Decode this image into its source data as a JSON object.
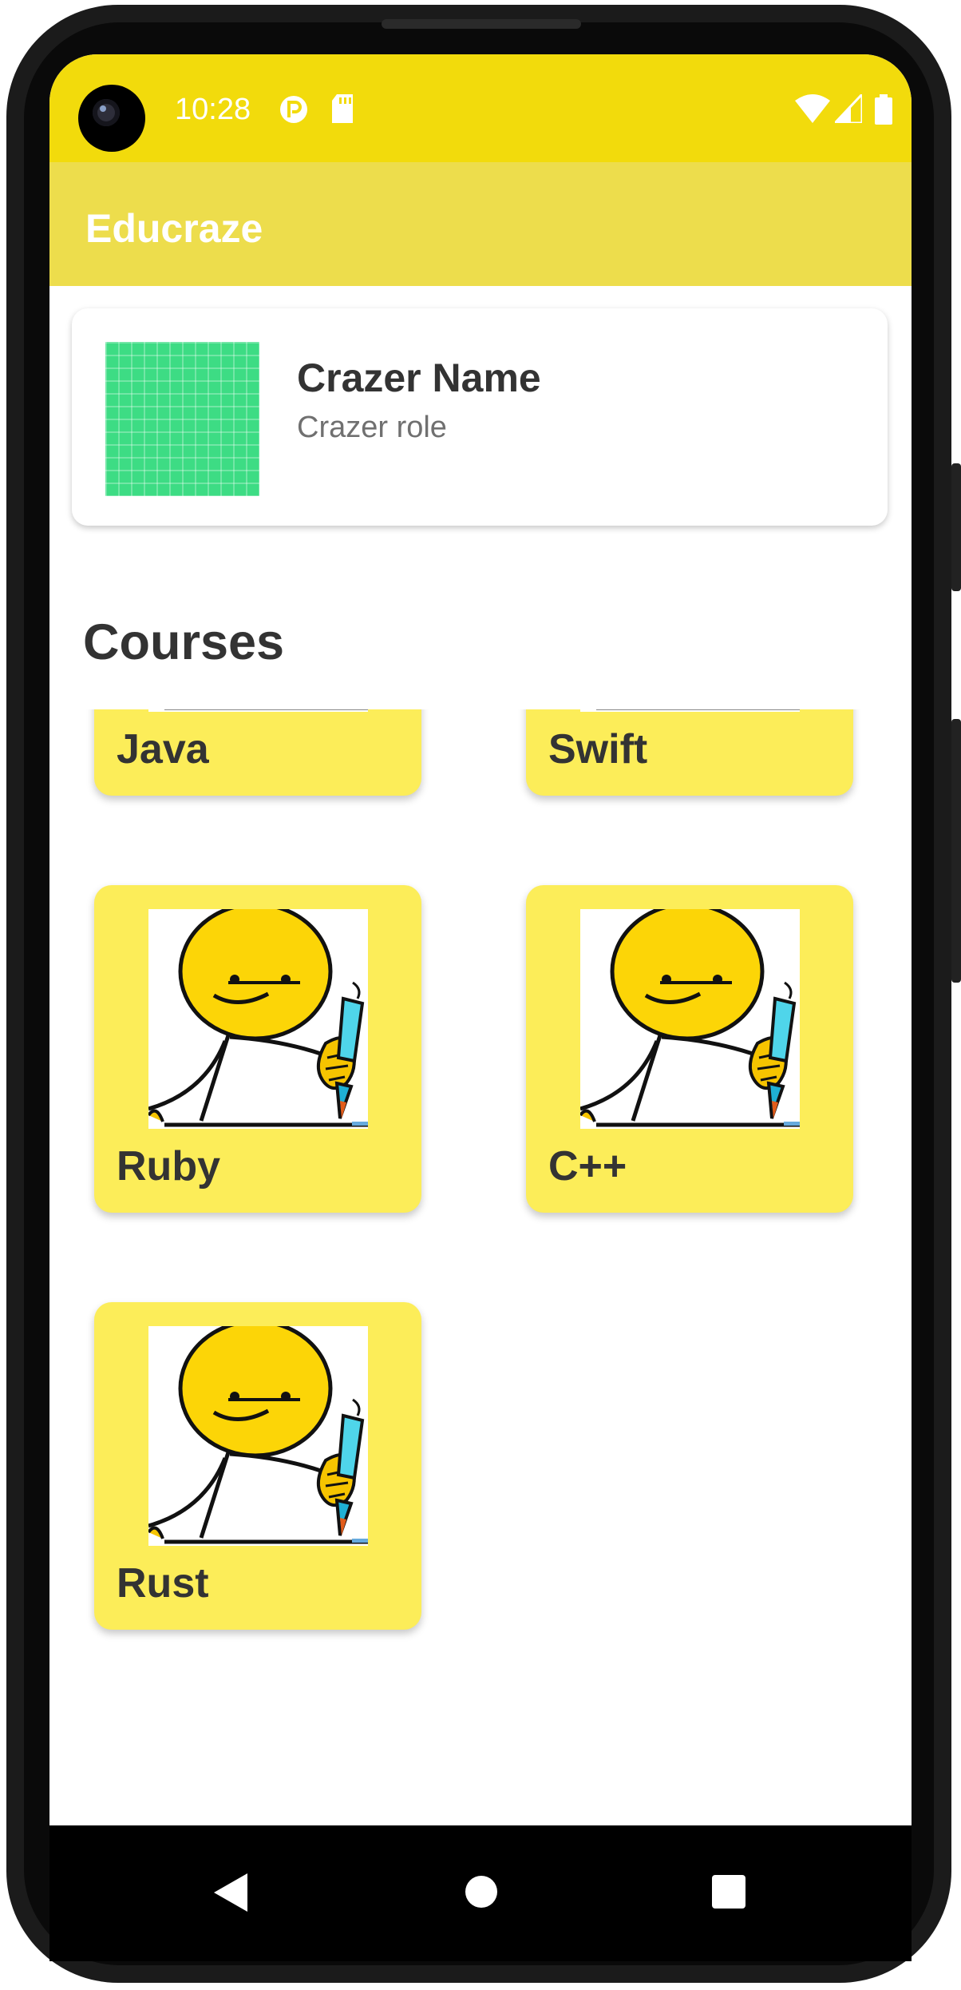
{
  "status": {
    "time": "10:28",
    "icons": [
      "notification-r-icon",
      "sd-card-icon",
      "wifi-icon",
      "signal-icon",
      "battery-icon"
    ]
  },
  "colors": {
    "status_bar": "#f2db0c",
    "app_bar": "#eddd4c",
    "card": "#fced59",
    "avatar": "#3ddc84",
    "text_dark": "#333333",
    "text_muted": "#707070"
  },
  "app_bar": {
    "title": "Educraze"
  },
  "profile": {
    "name": "Crazer Name",
    "role": "Crazer role"
  },
  "courses": {
    "title": "Courses",
    "items": [
      {
        "label": "Java"
      },
      {
        "label": "Swift"
      },
      {
        "label": "Ruby"
      },
      {
        "label": "C++"
      },
      {
        "label": "Rust"
      }
    ]
  },
  "nav": {
    "icons": [
      "back-icon",
      "home-icon",
      "recents-icon"
    ]
  }
}
